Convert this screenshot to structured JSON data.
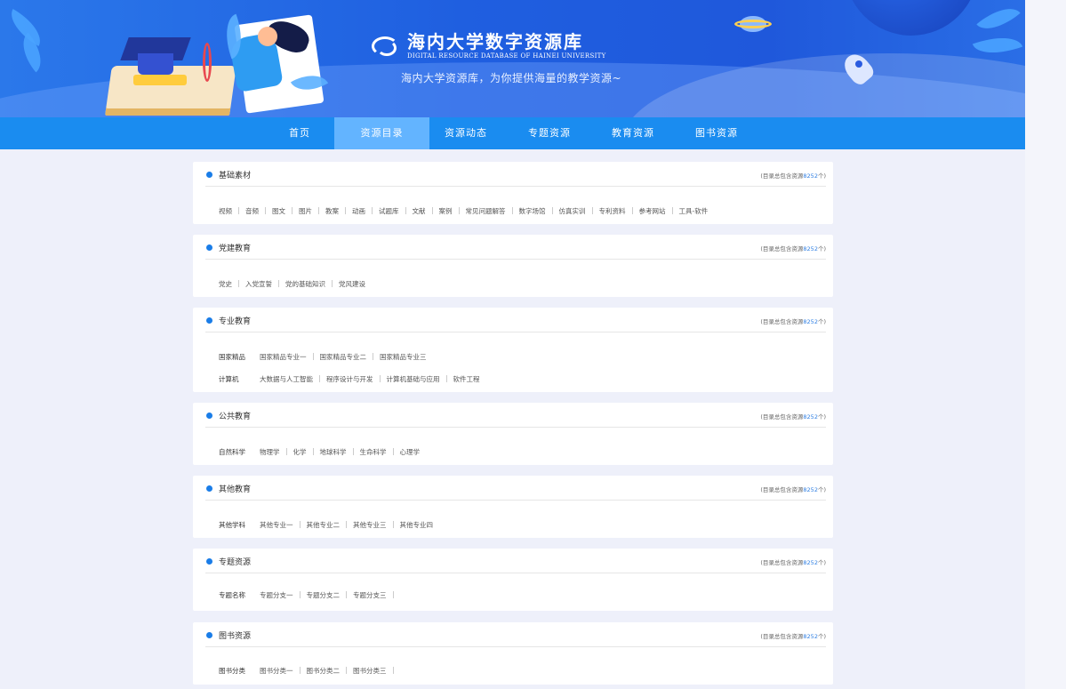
{
  "header": {
    "logo_cn": "海内大学数字资源库",
    "logo_en": "DIGITAL RESOURCE DATABASE OF HAINEI UNIVERSITY",
    "slogan": "海内大学资源库，为你提供海量的教学资源~"
  },
  "nav": {
    "items": [
      "首页",
      "资源目录",
      "资源动态",
      "专题资源",
      "教育资源",
      "图书资源"
    ],
    "active": "资源目录"
  },
  "count_prefix": "(目录总包含资源",
  "count_suffix": "个)",
  "sections": [
    {
      "title": "基础素材",
      "count": "8252",
      "rows": [
        {
          "label": "",
          "items": [
            "视频",
            "音频",
            "图文",
            "图片",
            "教案",
            "动画",
            "试题库",
            "文献",
            "案例",
            "常见问题解答",
            "数字场馆",
            "仿真实训",
            "专利资料",
            "参考网站",
            "工具-软件"
          ]
        }
      ]
    },
    {
      "title": "党建教育",
      "count": "8252",
      "rows": [
        {
          "label": "",
          "items": [
            "党史",
            "入党宣誓",
            "党的基础知识",
            "党风建设"
          ]
        }
      ]
    },
    {
      "title": "专业教育",
      "count": "8252",
      "rows": [
        {
          "label": "国家精品",
          "items": [
            "国家精品专业一",
            "国家精品专业二",
            "国家精品专业三"
          ]
        },
        {
          "label": "计算机",
          "items": [
            "大数据与人工智能",
            "程序设计与开发",
            "计算机基础与应用",
            "软件工程"
          ]
        }
      ]
    },
    {
      "title": "公共教育",
      "count": "8252",
      "rows": [
        {
          "label": "自然科学",
          "items": [
            "物理学",
            "化学",
            "地球科学",
            "生命科学",
            "心理学"
          ]
        }
      ]
    },
    {
      "title": "其他教育",
      "count": "8252",
      "rows": [
        {
          "label": "其他学科",
          "items": [
            "其他专业一",
            "其他专业二",
            "其他专业三",
            "其他专业四"
          ]
        }
      ]
    },
    {
      "title": "专题资源",
      "count": "8252",
      "rows": [
        {
          "label": "专题名称",
          "items": [
            "专题分支一",
            "专题分支二",
            "专题分支三"
          ]
        }
      ]
    },
    {
      "title": "图书资源",
      "count": "8252",
      "rows": [
        {
          "label": "图书分类",
          "items": [
            "图书分类一",
            "图书分类二",
            "图书分类三"
          ]
        }
      ]
    }
  ]
}
